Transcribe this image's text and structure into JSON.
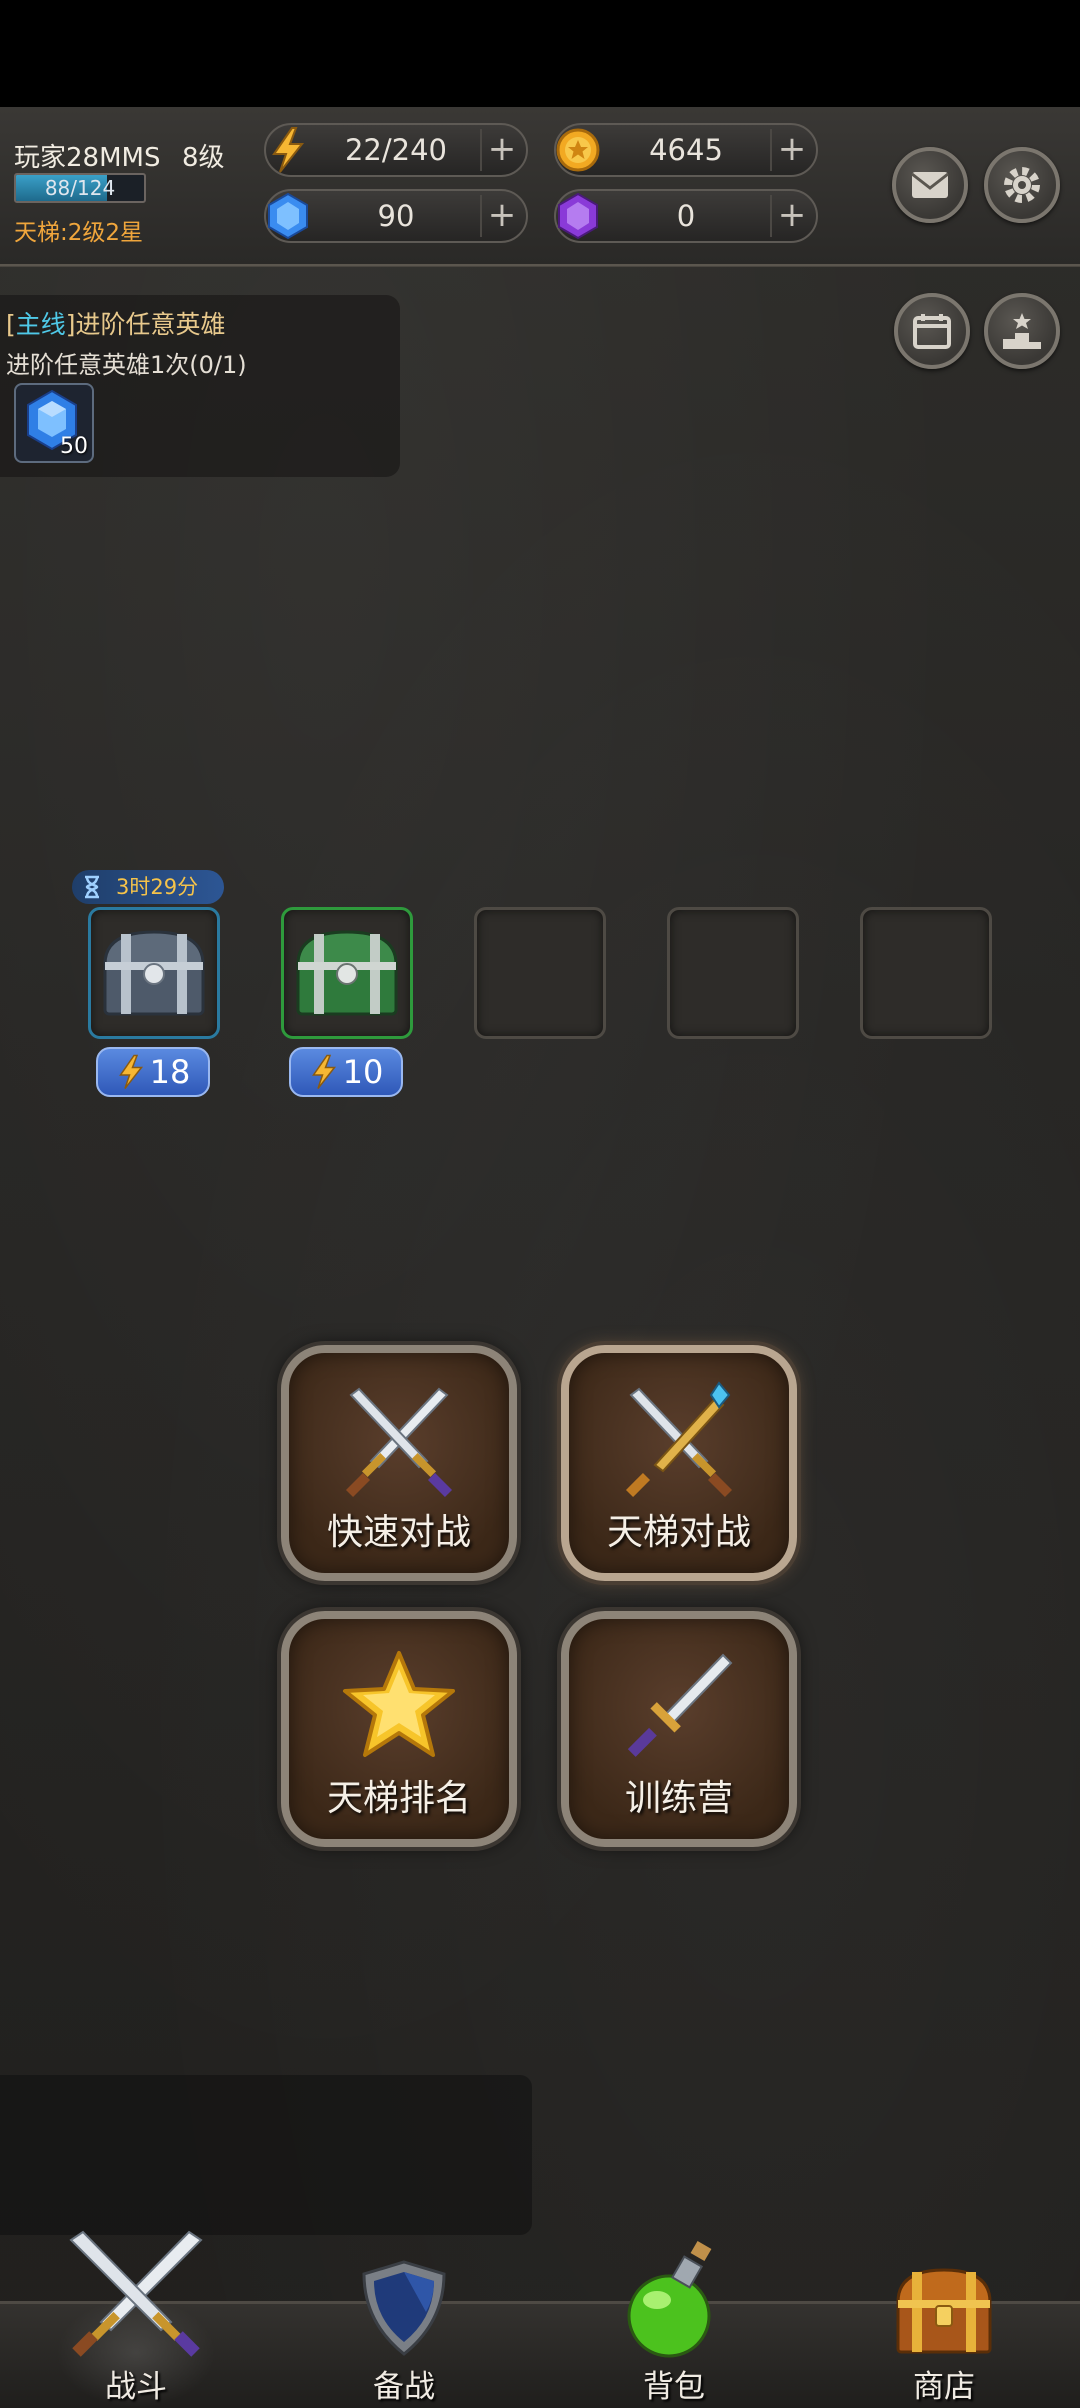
{
  "player": {
    "name": "玩家28MMS",
    "level": "8级",
    "xp_text": "88/124",
    "xp_fraction": 0.71,
    "ladder_rank": "天梯:2级2星"
  },
  "resources": {
    "energy": {
      "value": "22/240",
      "plus": "+"
    },
    "gold": {
      "value": "4645",
      "plus": "+"
    },
    "gems": {
      "value": "90",
      "plus": "+"
    },
    "purple": {
      "value": "0",
      "plus": "+"
    }
  },
  "quest": {
    "tag_open": "[",
    "tag": "主线",
    "tag_close": "]",
    "title": "进阶任意英雄",
    "desc": "进阶任意英雄1次(0/1)",
    "reward_count": "50"
  },
  "chests": {
    "timer": "3时29分",
    "slots": [
      {
        "cost": "18",
        "color": "#2a7aa0"
      },
      {
        "cost": "10",
        "color": "#2e9a3c"
      }
    ]
  },
  "main_buttons": {
    "quick_battle": "快速对战",
    "ladder_battle": "天梯对战",
    "ladder_ranking": "天梯排名",
    "training_camp": "训练营"
  },
  "nav": {
    "battle": "战斗",
    "prepare": "备战",
    "bag": "背包",
    "shop": "商店"
  },
  "icons": {
    "mail": "mail-icon",
    "settings": "gear-icon",
    "calendar": "calendar-icon",
    "podium": "podium-icon"
  }
}
